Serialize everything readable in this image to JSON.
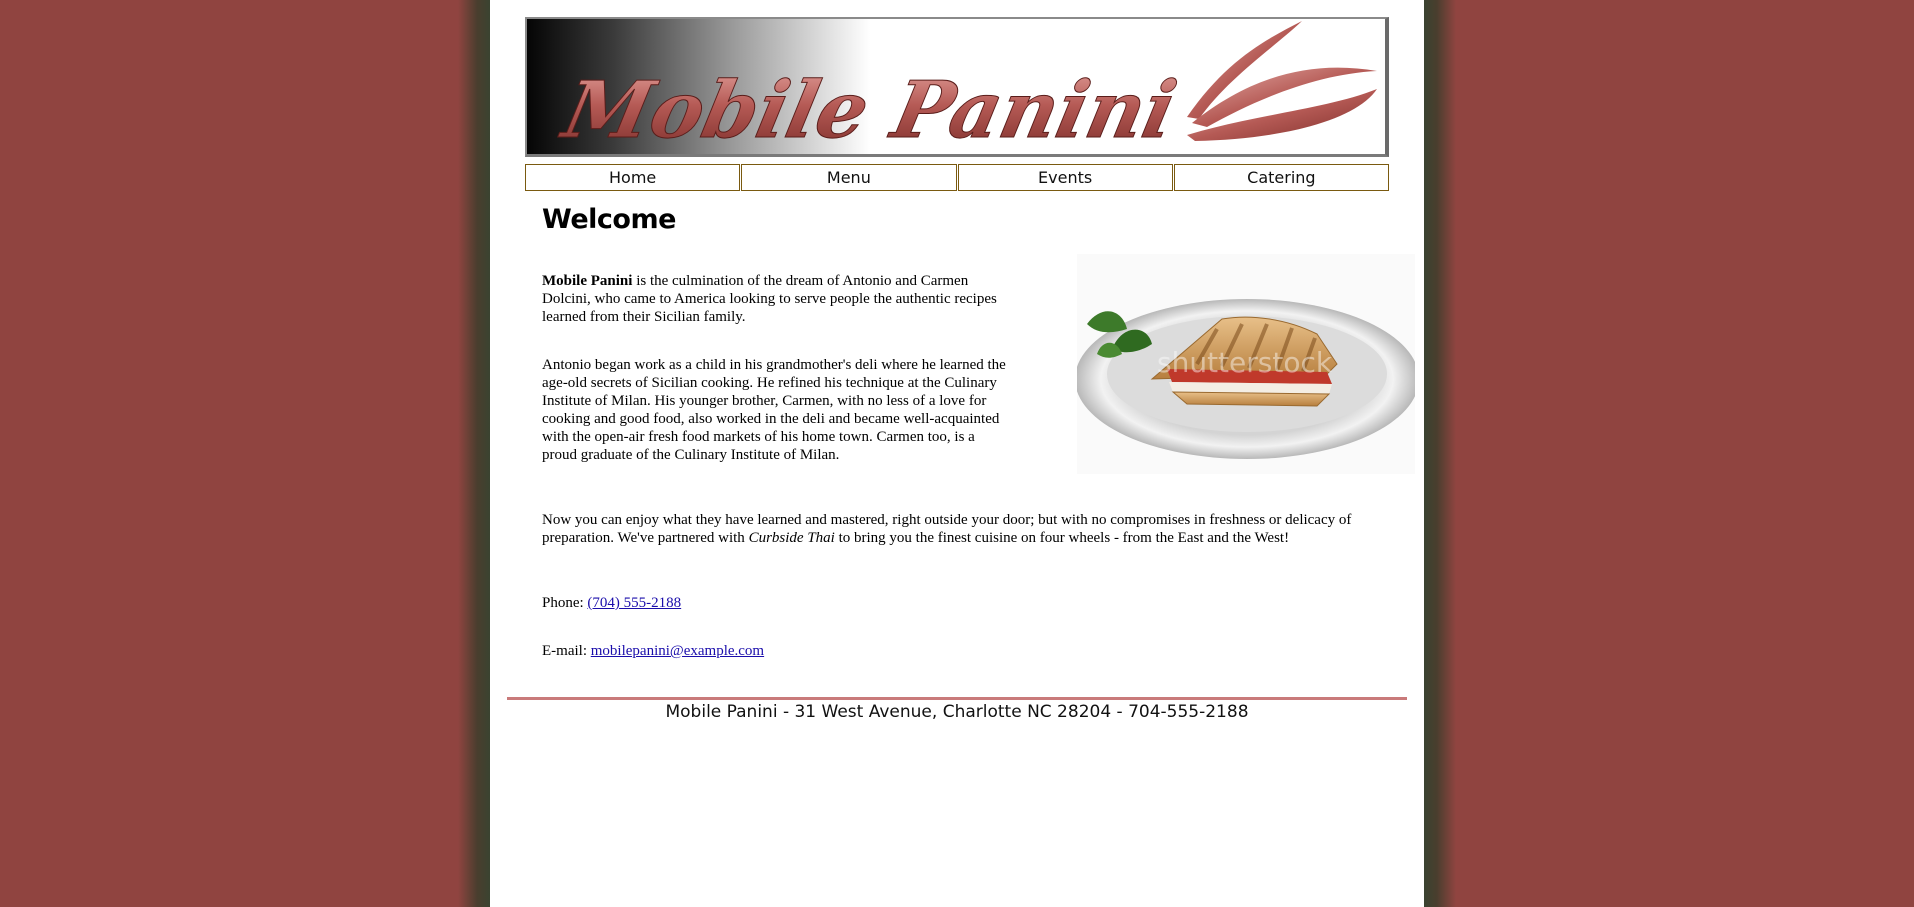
{
  "banner": {
    "logo_text": "Mobile Panini"
  },
  "nav": {
    "items": [
      {
        "label": "Home"
      },
      {
        "label": "Menu"
      },
      {
        "label": "Events"
      },
      {
        "label": "Catering"
      }
    ]
  },
  "main": {
    "heading": "Welcome",
    "p1_bold": "Mobile Panini",
    "p1_rest": " is the culmination of the dream of Antonio and Carmen Dolcini, who came to America looking to serve people the authentic recipes learned from their Sicilian family.",
    "p2": "Antonio began work as a child in his grandmother's deli where he learned the age-old secrets of Sicilian cooking. He refined his technique at the Culinary Institute of Milan. His younger brother, Carmen, with no less of a love for cooking and good food, also worked in the deli and became well-acquainted with the open-air fresh food markets of his home town. Carmen too, is a proud graduate of the Culinary Institute of Milan.",
    "p3_a": "Now you can enjoy what they have learned and mastered, right outside your door; but with no compromises in freshness or delicacy of preparation. We've partnered with ",
    "p3_italic": "Curbside Thai",
    "p3_b": " to bring you the finest cuisine on four wheels - from the East and the West!",
    "phone_label": "Phone: ",
    "phone_value": "(704) 555-2188",
    "email_label": "E-mail: ",
    "email_value": "mobilepanini@example.com",
    "photo_watermark": "shutterstock"
  },
  "footer": {
    "text": "Mobile Panini - 31 West Avenue, Charlotte NC 28204 - 704-555-2188"
  },
  "colors": {
    "page_background": "#904440",
    "logo_red": "#b55a55",
    "nav_border": "#7a5a10",
    "footer_rule": "#c97a7a",
    "link": "#1a0dab"
  }
}
